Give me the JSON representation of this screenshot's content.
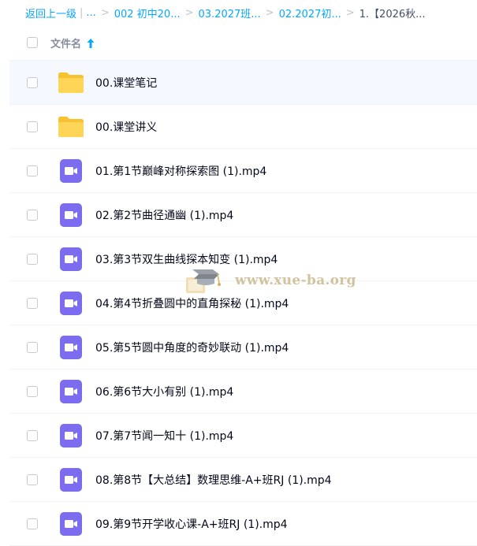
{
  "breadcrumb": {
    "back": "返回上一级",
    "sep_bar": "|",
    "ellipsis": "...",
    "items": [
      "002 初中20...",
      "03.2027班...",
      "02.2027初..."
    ],
    "current": "1.【2026秋..."
  },
  "header": {
    "name_label": "文件名"
  },
  "files": [
    {
      "name": "00.课堂笔记",
      "type": "folder"
    },
    {
      "name": "00.课堂讲义",
      "type": "folder"
    },
    {
      "name": "01.第1节巅峰对称探索图 (1).mp4",
      "type": "video"
    },
    {
      "name": "02.第2节曲径通幽 (1).mp4",
      "type": "video"
    },
    {
      "name": "03.第3节双生曲线探本知变 (1).mp4",
      "type": "video"
    },
    {
      "name": "04.第4节折叠圆中的直角探秘 (1).mp4",
      "type": "video"
    },
    {
      "name": "05.第5节圆中角度的奇妙联动 (1).mp4",
      "type": "video"
    },
    {
      "name": "06.第6节大小有别 (1).mp4",
      "type": "video"
    },
    {
      "name": "07.第7节闻一知十 (1).mp4",
      "type": "video"
    },
    {
      "name": "08.第8节【大总结】数理思维-A+班RJ (1).mp4",
      "type": "video"
    },
    {
      "name": "09.第9节开学收心课-A+班RJ (1).mp4",
      "type": "video"
    }
  ],
  "watermark": {
    "text": "www.xue-ba.org"
  },
  "colors": {
    "link": "#06a7ff",
    "folder": "#ffd04d",
    "video": "#7c6cf0",
    "hover_row": "#f5f9ff"
  }
}
